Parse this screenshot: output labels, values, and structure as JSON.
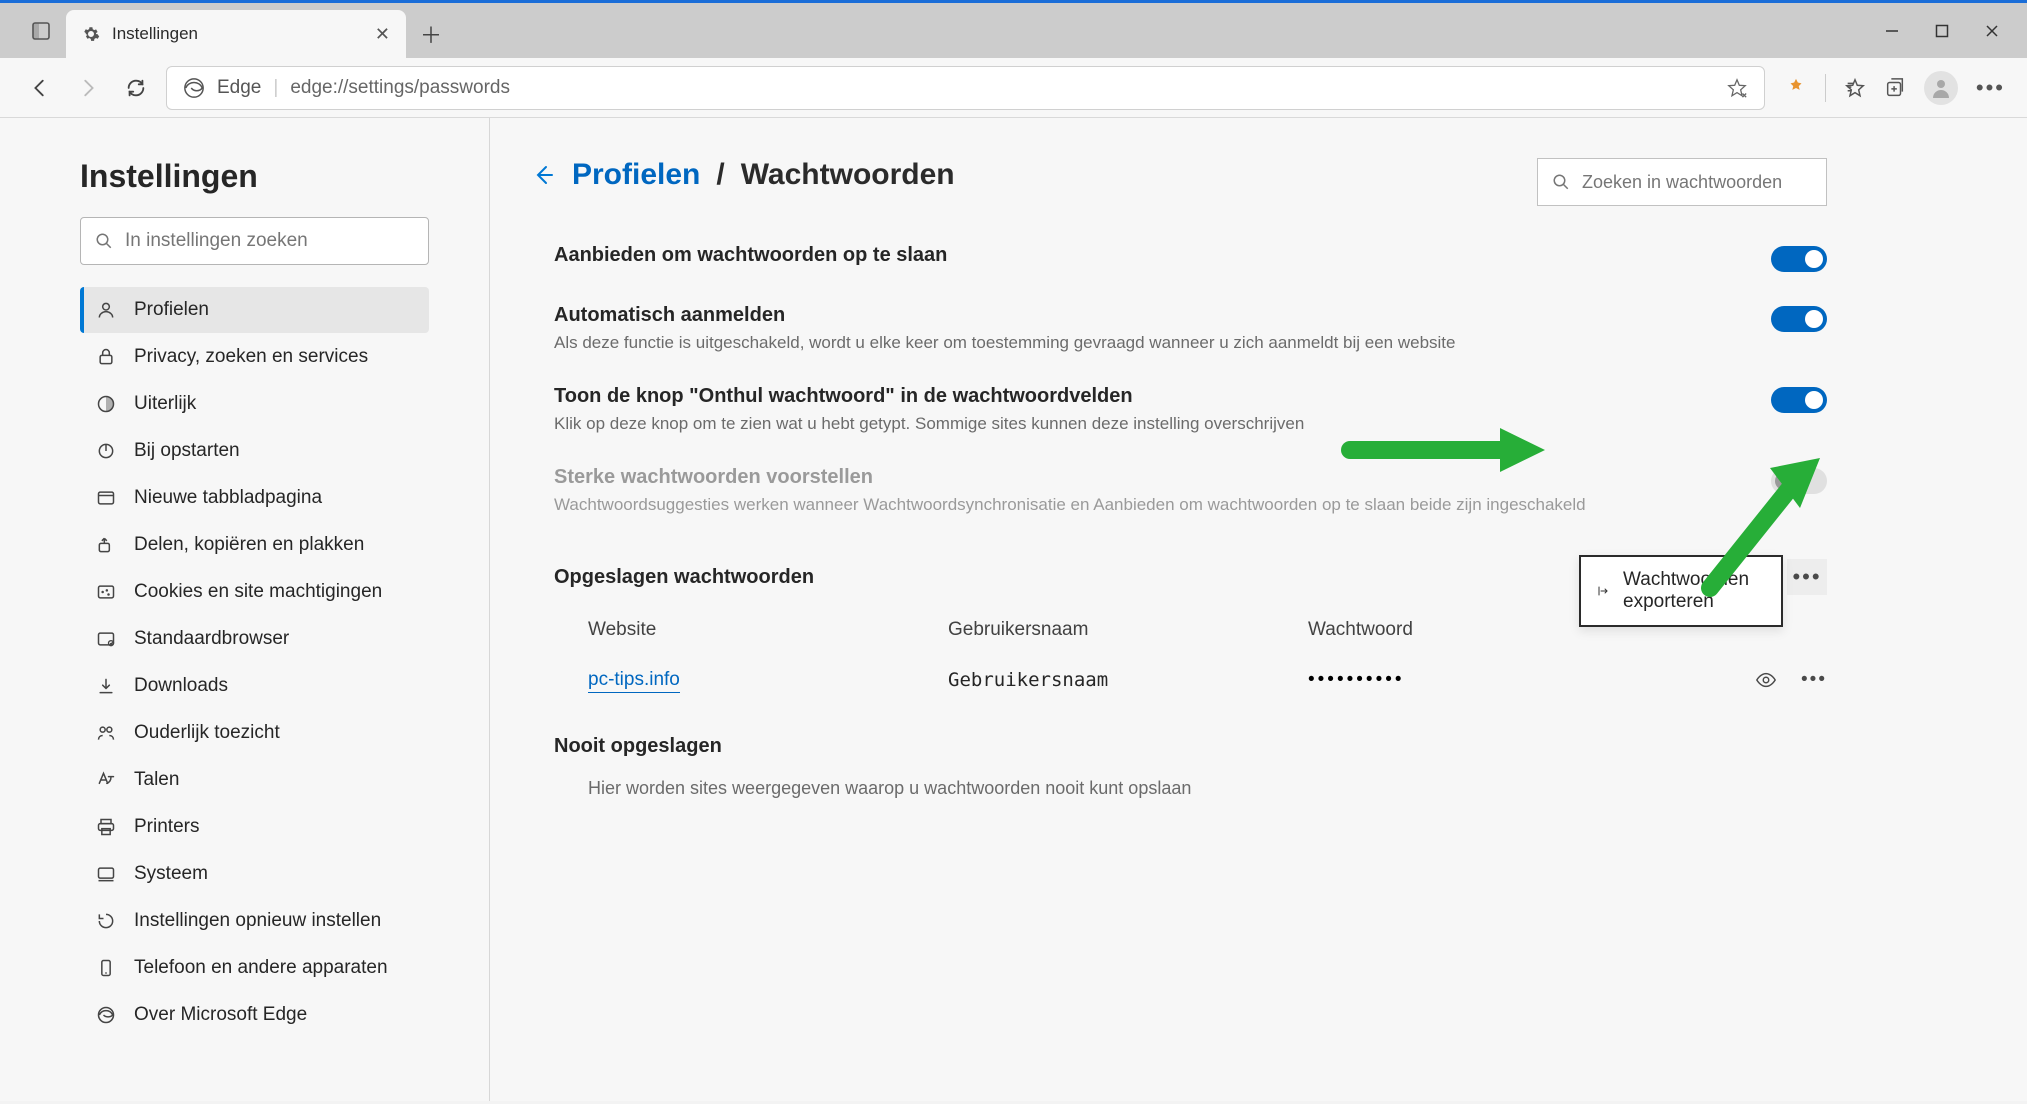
{
  "tab": {
    "title": "Instellingen"
  },
  "address": {
    "app": "Edge",
    "url": "edge://settings/passwords"
  },
  "sidebar": {
    "title": "Instellingen",
    "search_placeholder": "In instellingen zoeken",
    "items": [
      {
        "label": "Profielen",
        "icon": "person",
        "selected": true
      },
      {
        "label": "Privacy, zoeken en services",
        "icon": "lock"
      },
      {
        "label": "Uiterlijk",
        "icon": "appearance"
      },
      {
        "label": "Bij opstarten",
        "icon": "power"
      },
      {
        "label": "Nieuwe tabbladpagina",
        "icon": "newtab"
      },
      {
        "label": "Delen, kopiëren en plakken",
        "icon": "share"
      },
      {
        "label": "Cookies en site machtigingen",
        "icon": "cookies"
      },
      {
        "label": "Standaardbrowser",
        "icon": "default"
      },
      {
        "label": "Downloads",
        "icon": "download"
      },
      {
        "label": "Ouderlijk toezicht",
        "icon": "family"
      },
      {
        "label": "Talen",
        "icon": "language"
      },
      {
        "label": "Printers",
        "icon": "printer"
      },
      {
        "label": "Systeem",
        "icon": "system"
      },
      {
        "label": "Instellingen opnieuw instellen",
        "icon": "reset"
      },
      {
        "label": "Telefoon en andere apparaten",
        "icon": "phone"
      },
      {
        "label": "Over Microsoft Edge",
        "icon": "edge"
      }
    ]
  },
  "breadcrumb": {
    "link": "Profielen",
    "current": "Wachtwoorden"
  },
  "pw_search_placeholder": "Zoeken in wachtwoorden",
  "settings": [
    {
      "title": "Aanbieden om wachtwoorden op te slaan",
      "desc": "",
      "on": true
    },
    {
      "title": "Automatisch aanmelden",
      "desc": "Als deze functie is uitgeschakeld, wordt u elke keer om toestemming gevraagd wanneer u zich aanmeldt bij een website",
      "on": true
    },
    {
      "title": "Toon de knop \"Onthul wachtwoord\" in de wachtwoordvelden",
      "desc": "Klik op deze knop om te zien wat u hebt getypt. Sommige sites kunnen deze instelling overschrijven",
      "on": true
    },
    {
      "title": "Sterke wachtwoorden voorstellen",
      "desc": "Wachtwoordsuggesties werken wanneer Wachtwoordsynchronisatie en Aanbieden om wachtwoorden op te slaan beide zijn ingeschakeld",
      "on": false,
      "disabled": true
    }
  ],
  "saved": {
    "header": "Opgeslagen wachtwoorden",
    "export_label": "Wachtwoorden exporteren",
    "cols": {
      "site": "Website",
      "user": "Gebruikersnaam",
      "pw": "Wachtwoord"
    },
    "rows": [
      {
        "site": "pc-tips.info",
        "user": "Gebruikersnaam",
        "pw": "••••••••••"
      }
    ]
  },
  "never": {
    "header": "Nooit opgeslagen",
    "desc": "Hier worden sites weergegeven waarop u wachtwoorden nooit kunt opslaan"
  }
}
